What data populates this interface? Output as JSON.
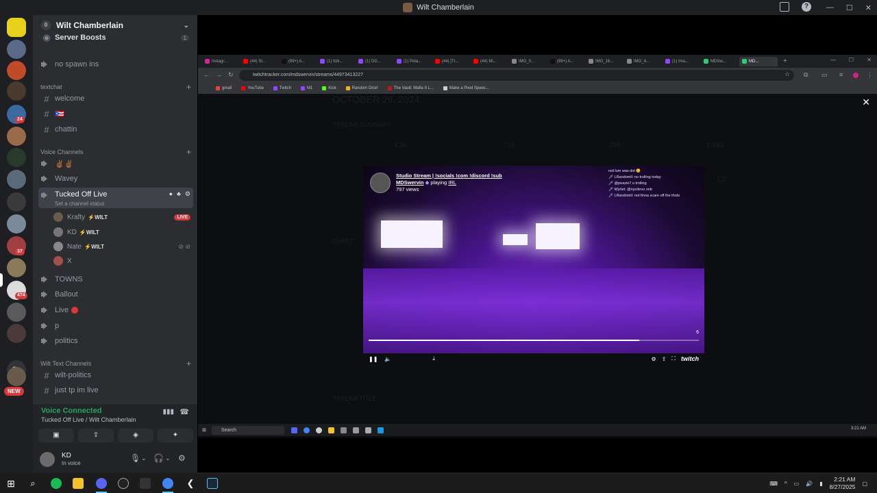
{
  "window": {
    "title": "Wilt Chamberlain"
  },
  "guild": {
    "name": "Wilt Chamberlain",
    "tag": "0",
    "server_boosts": "Server Boosts",
    "server_boosts_count": "1"
  },
  "server_badges": {
    "b1": "24",
    "b2": "37",
    "b3": "474",
    "new": "NEW",
    "cs": "Cs"
  },
  "channels": {
    "no_spawn": "no spawn ins",
    "cat_textchat": "textchat",
    "welcome": "welcome",
    "flag": "🇵🇷",
    "chattin": "chattin",
    "cat_voice": "Voice Channels",
    "v1": "✌🏾✌🏾",
    "wavey": "Wavey",
    "tucked": "Tucked Off Live",
    "set_status": "Set a channel status",
    "towns": "TOWNS",
    "ballout": "Ballout",
    "live": "Live",
    "p": "p",
    "politics": "politics",
    "cat_wilt": "Wilt Text Channels",
    "wilt_politics": "wilt-politics",
    "just_tp": "just tp im live"
  },
  "voice_users": [
    {
      "name": "Krafty",
      "tag": "⚡WILT",
      "live": "LIVE"
    },
    {
      "name": "KD",
      "tag": "⚡WILT"
    },
    {
      "name": "Nate",
      "tag": "⚡WILT"
    },
    {
      "name": "X"
    }
  ],
  "voice_panel": {
    "status": "Voice Connected",
    "location": "Tucked Off Live / Wilt Chamberlain"
  },
  "user": {
    "name": "KD",
    "status": "In voice"
  },
  "browser": {
    "tabs": [
      "Instagr...",
      "(44) St...",
      "(99+) A...",
      "(1) Itzk...",
      "(1) DD...",
      "(1) Peta...",
      "(44) [TI...",
      "(44) Mi...",
      "IMG_0...",
      "(99+) A...",
      "IMG_16...",
      "IMG_4...",
      "(1) Ima...",
      "MDSw...",
      "MD..."
    ],
    "url": "twitchtracker.com/mdswervin/streams/44973413227",
    "bookmarks": [
      "gmail",
      "YouTube",
      "Twitch",
      "M1",
      "Kick",
      "Random Dice!",
      "The Vault: Mafia II L...",
      "Make a Pixel Speec..."
    ]
  },
  "page_ghost": {
    "date": "OCTOBER 29, 2024",
    "summary": "STREAM SUMMARY",
    "s1": "4.8k",
    "s2": "716",
    "s3": "359",
    "s4": "1,934",
    "s5": "1.2",
    "chart": "CHART",
    "stream_title": "STREAM TITLE"
  },
  "video": {
    "title": "Studio Stream | !socials !com !discord !sub",
    "channel": "MDSwervin",
    "playing": "playing",
    "game": "IRL",
    "views": "797 views",
    "chat": [
      "red lum was dot 😊",
      "🗡 LRandomll: no trolling today",
      "🗡 @peazie7 u trolling",
      "🗡 Wyrlet: @nycdevo onb",
      "🗡 LRandomll: not finna scare off the thots"
    ],
    "counter": "6",
    "progress": 0.82,
    "brand": "twitch"
  },
  "inner_taskbar": {
    "search": "Search",
    "time": "3:21 AM"
  },
  "taskbar": {
    "time": "2:21 AM",
    "date": "8/27/2025"
  }
}
